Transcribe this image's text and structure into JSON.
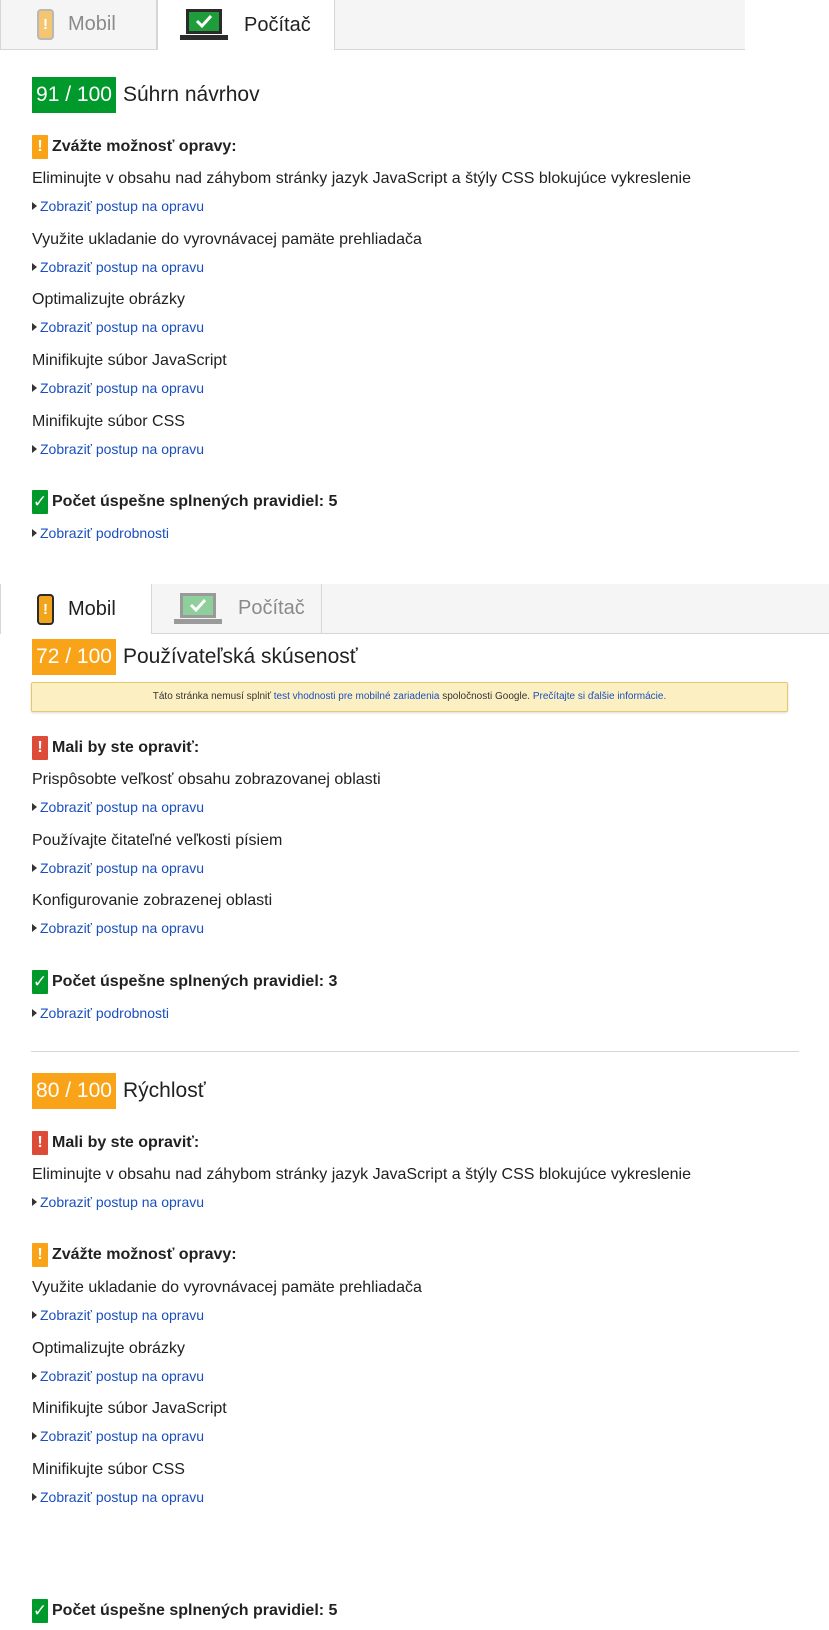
{
  "tabs": {
    "mobile_label": "Mobil",
    "desktop_label": "Počítač"
  },
  "desktop_summary": {
    "score": "91 / 100",
    "title": "Súhrn návrhov",
    "consider_heading": "Zvážte možnosť opravy:",
    "rules": [
      {
        "title": "Eliminujte v obsahu nad záhybom stránky jazyk JavaScript a štýly CSS blokujúce vykreslenie",
        "link": "Zobraziť postup na opravu"
      },
      {
        "title": "Využite ukladanie do vyrovnávacej pamäte prehliadača",
        "link": "Zobraziť postup na opravu"
      },
      {
        "title": "Optimalizujte obrázky",
        "link": "Zobraziť postup na opravu"
      },
      {
        "title": "Minifikujte súbor JavaScript",
        "link": "Zobraziť postup na opravu"
      },
      {
        "title": "Minifikujte súbor CSS",
        "link": "Zobraziť postup na opravu"
      }
    ],
    "passed_heading": "Počet úspešne splnených pravidiel: 5",
    "details_link": "Zobraziť podrobnosti"
  },
  "mobile_ux": {
    "score": "72 / 100",
    "title": "Používateľská skúsenosť",
    "notice": {
      "text1": "Táto stránka nemusí splniť ",
      "link1": "test vhodnosti pre mobilné zariadenia",
      "text2": " spoločnosti Google. ",
      "link2": "Prečítajte si ďalšie informácie."
    },
    "fix_heading": "Mali by ste opraviť:",
    "rules": [
      {
        "title": "Prispôsobte veľkosť obsahu zobrazovanej oblasti",
        "link": "Zobraziť postup na opravu"
      },
      {
        "title": "Používajte čitateľné veľkosti písiem",
        "link": "Zobraziť postup na opravu"
      },
      {
        "title": "Konfigurovanie zobrazenej oblasti",
        "link": "Zobraziť postup na opravu"
      }
    ],
    "passed_heading": "Počet úspešne splnených pravidiel: 3",
    "details_link": "Zobraziť podrobnosti"
  },
  "mobile_speed": {
    "score": "80 / 100",
    "title": "Rýchlosť",
    "fix_heading": "Mali by ste opraviť:",
    "fix_rules": [
      {
        "title": "Eliminujte v obsahu nad záhybom stránky jazyk JavaScript a štýly CSS blokujúce vykreslenie",
        "link": "Zobraziť postup na opravu"
      }
    ],
    "consider_heading": "Zvážte možnosť opravy:",
    "consider_rules": [
      {
        "title": "Využite ukladanie do vyrovnávacej pamäte prehliadača",
        "link": "Zobraziť postup na opravu"
      },
      {
        "title": "Optimalizujte obrázky",
        "link": "Zobraziť postup na opravu"
      },
      {
        "title": "Minifikujte súbor JavaScript",
        "link": "Zobraziť postup na opravu"
      },
      {
        "title": "Minifikujte súbor CSS",
        "link": "Zobraziť postup na opravu"
      }
    ],
    "passed_heading": "Počet úspešne splnených pravidiel: 5"
  },
  "colors": {
    "score_good": "#009a2c",
    "score_average": "#f9a418",
    "error": "#dd4b39",
    "link": "#1a4fbf"
  },
  "icons": {
    "mobile": "phone-icon",
    "desktop": "laptop-icon",
    "warning": "exclamation-icon",
    "passed": "checkmark-icon",
    "expand": "triangle-right-icon"
  }
}
